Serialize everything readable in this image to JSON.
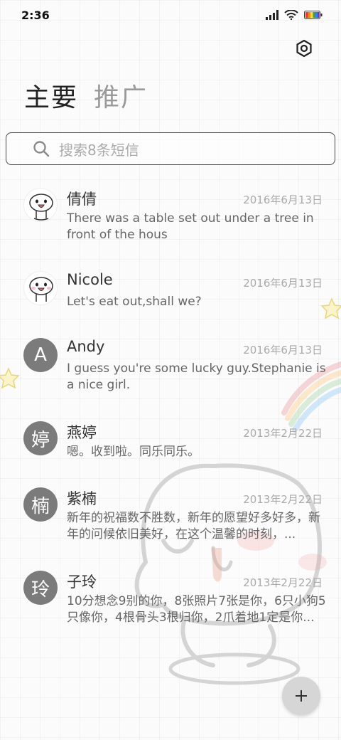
{
  "status_bar": {
    "time": "2:36",
    "icons": [
      "signal-icon",
      "wifi-icon",
      "battery-icon"
    ]
  },
  "header": {
    "settings_icon": "settings-icon",
    "tabs": [
      {
        "label": "主要",
        "active": true
      },
      {
        "label": "推广",
        "active": false
      }
    ]
  },
  "search": {
    "placeholder": "搜索8条短信"
  },
  "messages": [
    {
      "name": "倩倩",
      "date": "2016年6月13日",
      "preview": "There was a table set out under a tree in front of the hous",
      "avatar_type": "image",
      "avatar_letter": ""
    },
    {
      "name": "Nicole",
      "date": "2016年6月13日",
      "preview": "Let's eat out,shall we?",
      "avatar_type": "image",
      "avatar_letter": ""
    },
    {
      "name": "Andy",
      "date": "2016年6月13日",
      "preview": "I guess you're some lucky guy.Stephanie is a nice girl.",
      "avatar_type": "letter",
      "avatar_letter": "A"
    },
    {
      "name": "燕婷",
      "date": "2013年2月22日",
      "preview": "嗯。收到啦。同乐同乐。",
      "avatar_type": "letter",
      "avatar_letter": "婷"
    },
    {
      "name": "紫楠",
      "date": "2013年2月22日",
      "preview": "新年的祝福数不胜数，新年的愿望好多好多，新年的问候依旧美好，在这个温馨的时刻，...",
      "avatar_type": "letter",
      "avatar_letter": "楠"
    },
    {
      "name": "子玲",
      "date": "2013年2月22日",
      "preview": "10分想念9别的你，8张照片7张是你，6只小狗5只像你，4根骨头3根归你，2爪着地1定是你...",
      "avatar_type": "letter",
      "avatar_letter": "玲"
    }
  ],
  "fab": {
    "icon": "plus-icon"
  },
  "colors": {
    "avatar_gray": "#7b7b7b",
    "fab_gray": "#d6d6d6"
  }
}
